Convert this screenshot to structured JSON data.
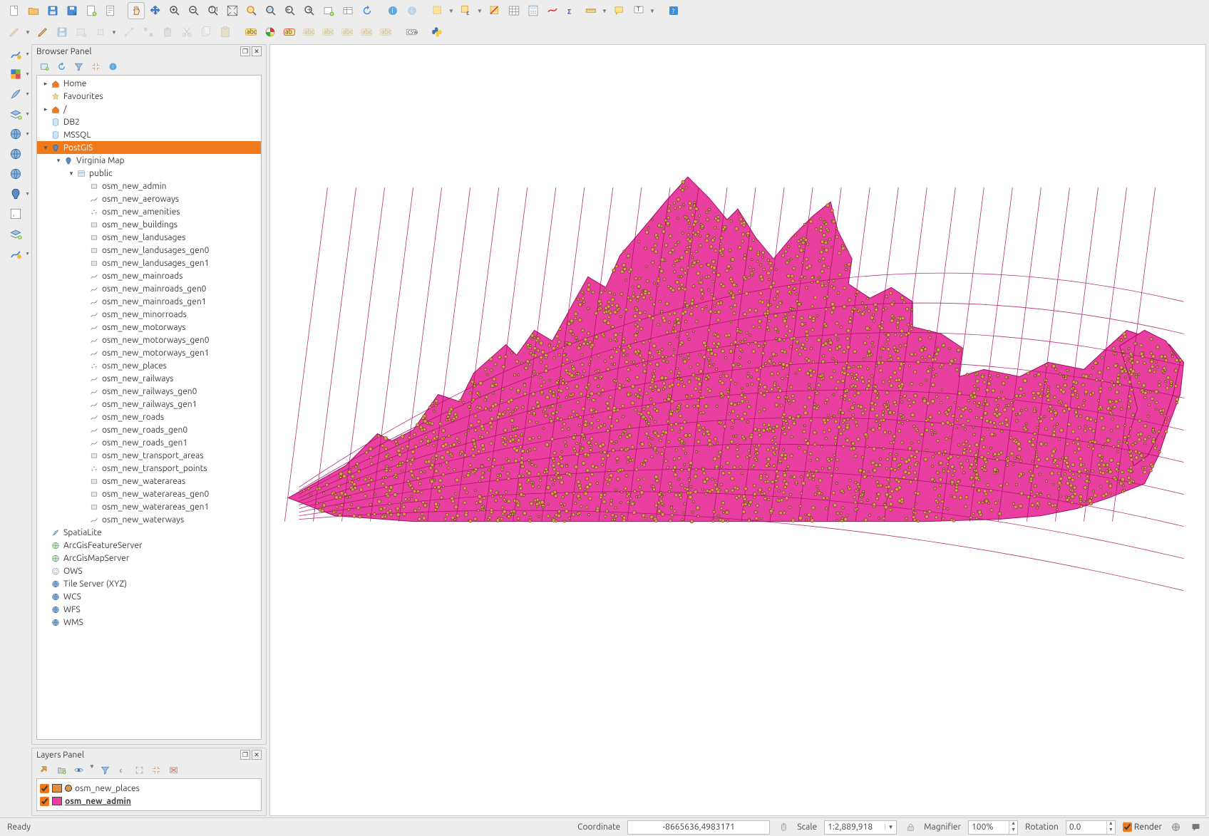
{
  "browser_panel_title": "Browser Panel",
  "layers_panel_title": "Layers Panel",
  "browser_tree": [
    {
      "d": 0,
      "tw": "▸",
      "icon": "folder-orange",
      "label": "Home"
    },
    {
      "d": 0,
      "tw": "",
      "icon": "star",
      "label": "Favourites"
    },
    {
      "d": 0,
      "tw": "▸",
      "icon": "folder-orange",
      "label": "/"
    },
    {
      "d": 0,
      "tw": "",
      "icon": "db-blue",
      "label": "DB2"
    },
    {
      "d": 0,
      "tw": "",
      "icon": "db-dark",
      "label": "MSSQL"
    },
    {
      "d": 0,
      "tw": "▾",
      "icon": "db-postgis",
      "label": "PostGIS",
      "sel": true
    },
    {
      "d": 1,
      "tw": "▾",
      "icon": "pg-conn",
      "label": "Virginia Map"
    },
    {
      "d": 2,
      "tw": "▾",
      "icon": "schema",
      "label": "public"
    },
    {
      "d": 3,
      "tw": "",
      "icon": "poly",
      "label": "osm_new_admin"
    },
    {
      "d": 3,
      "tw": "",
      "icon": "line",
      "label": "osm_new_aeroways"
    },
    {
      "d": 3,
      "tw": "",
      "icon": "point",
      "label": "osm_new_amenities"
    },
    {
      "d": 3,
      "tw": "",
      "icon": "poly",
      "label": "osm_new_buildings"
    },
    {
      "d": 3,
      "tw": "",
      "icon": "poly",
      "label": "osm_new_landusages"
    },
    {
      "d": 3,
      "tw": "",
      "icon": "poly",
      "label": "osm_new_landusages_gen0"
    },
    {
      "d": 3,
      "tw": "",
      "icon": "poly",
      "label": "osm_new_landusages_gen1"
    },
    {
      "d": 3,
      "tw": "",
      "icon": "line",
      "label": "osm_new_mainroads"
    },
    {
      "d": 3,
      "tw": "",
      "icon": "line",
      "label": "osm_new_mainroads_gen0"
    },
    {
      "d": 3,
      "tw": "",
      "icon": "line",
      "label": "osm_new_mainroads_gen1"
    },
    {
      "d": 3,
      "tw": "",
      "icon": "line",
      "label": "osm_new_minorroads"
    },
    {
      "d": 3,
      "tw": "",
      "icon": "line",
      "label": "osm_new_motorways"
    },
    {
      "d": 3,
      "tw": "",
      "icon": "line",
      "label": "osm_new_motorways_gen0"
    },
    {
      "d": 3,
      "tw": "",
      "icon": "line",
      "label": "osm_new_motorways_gen1"
    },
    {
      "d": 3,
      "tw": "",
      "icon": "point",
      "label": "osm_new_places"
    },
    {
      "d": 3,
      "tw": "",
      "icon": "line",
      "label": "osm_new_railways"
    },
    {
      "d": 3,
      "tw": "",
      "icon": "line",
      "label": "osm_new_railways_gen0"
    },
    {
      "d": 3,
      "tw": "",
      "icon": "line",
      "label": "osm_new_railways_gen1"
    },
    {
      "d": 3,
      "tw": "",
      "icon": "line",
      "label": "osm_new_roads"
    },
    {
      "d": 3,
      "tw": "",
      "icon": "line",
      "label": "osm_new_roads_gen0"
    },
    {
      "d": 3,
      "tw": "",
      "icon": "line",
      "label": "osm_new_roads_gen1"
    },
    {
      "d": 3,
      "tw": "",
      "icon": "poly",
      "label": "osm_new_transport_areas"
    },
    {
      "d": 3,
      "tw": "",
      "icon": "point",
      "label": "osm_new_transport_points"
    },
    {
      "d": 3,
      "tw": "",
      "icon": "poly",
      "label": "osm_new_waterareas"
    },
    {
      "d": 3,
      "tw": "",
      "icon": "poly",
      "label": "osm_new_waterareas_gen0"
    },
    {
      "d": 3,
      "tw": "",
      "icon": "poly",
      "label": "osm_new_waterareas_gen1"
    },
    {
      "d": 3,
      "tw": "",
      "icon": "line",
      "label": "osm_new_waterways"
    },
    {
      "d": 0,
      "tw": "",
      "icon": "feather",
      "label": "SpatiaLite"
    },
    {
      "d": 0,
      "tw": "",
      "icon": "globe-g",
      "label": "ArcGisFeatureServer"
    },
    {
      "d": 0,
      "tw": "",
      "icon": "globe-g",
      "label": "ArcGisMapServer"
    },
    {
      "d": 0,
      "tw": "",
      "icon": "ows",
      "label": "OWS"
    },
    {
      "d": 0,
      "tw": "",
      "icon": "globe-b",
      "label": "Tile Server (XYZ)"
    },
    {
      "d": 0,
      "tw": "",
      "icon": "globe-b",
      "label": "WCS"
    },
    {
      "d": 0,
      "tw": "",
      "icon": "globe-b",
      "label": "WFS"
    },
    {
      "d": 0,
      "tw": "",
      "icon": "globe-b",
      "label": "WMS"
    }
  ],
  "layers": [
    {
      "label": "osm_new_places",
      "swatch": "#e58f3b",
      "dot": "#d9984f",
      "checked": true,
      "active": false
    },
    {
      "label": "osm_new_admin",
      "swatch": "#e93fa0",
      "dot": "",
      "checked": true,
      "active": true
    }
  ],
  "status": {
    "ready": "Ready",
    "coord_label": "Coordinate",
    "coord_value": "-8665636,4983171",
    "scale_label": "Scale",
    "scale_value": "1:2,889,918",
    "mag_label": "Magnifier",
    "mag_value": "100%",
    "rot_label": "Rotation",
    "rot_value": "0.0",
    "render_label": "Render"
  },
  "colors": {
    "selection": "#f0791c",
    "map_fill": "#e93fa0",
    "map_stroke": "#a60e63",
    "point_fill": "#d9984f",
    "point_stroke": "#5a3a18"
  }
}
